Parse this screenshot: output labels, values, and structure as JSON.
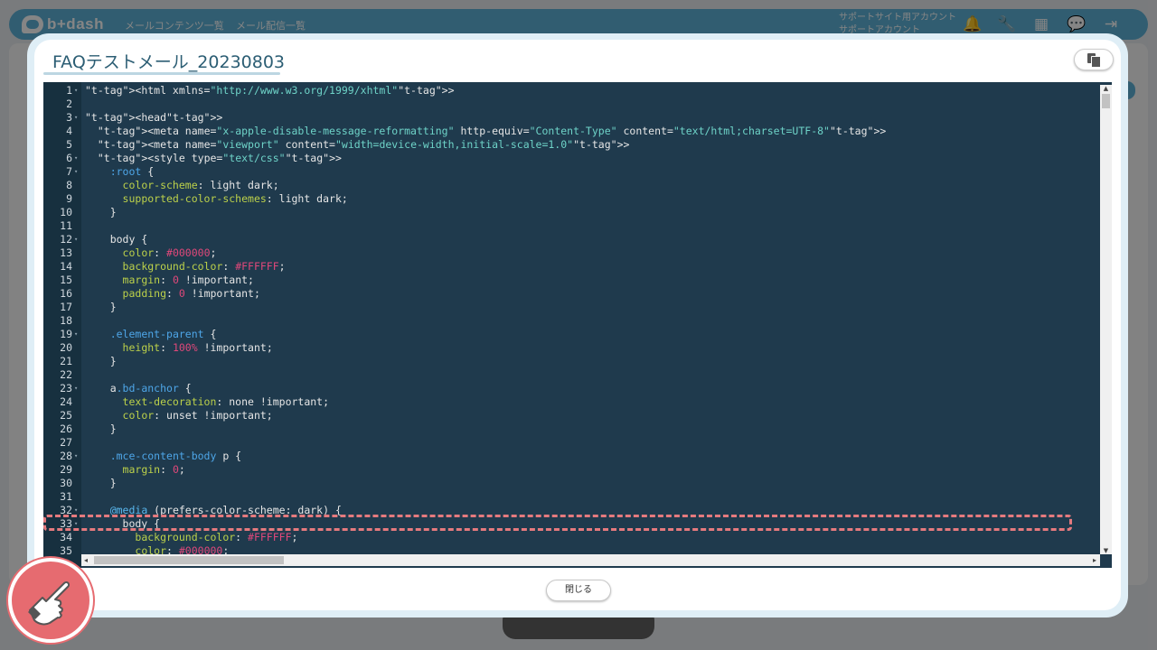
{
  "app": {
    "brand": "b+dash",
    "nav": [
      "メールコンテンツ一覧",
      "メール配信一覧"
    ],
    "account_line1": "サポートサイト用アカウント",
    "account_line2": "サポートアカウント",
    "icons": [
      "bell-icon",
      "wrench-icon",
      "grid-icon",
      "chat-icon",
      "logout-icon"
    ]
  },
  "modal": {
    "title": "FAQテストメール_20230803",
    "copy_icon": "copy-icon",
    "close_label": "閉じる"
  },
  "editor": {
    "lines": [
      "<html xmlns=\"http://www.w3.org/1999/xhtml\">",
      "",
      "<head>",
      "  <meta name=\"x-apple-disable-message-reformatting\" http-equiv=\"Content-Type\" content=\"text/html;charset=UTF-8\">",
      "  <meta name=\"viewport\" content=\"width=device-width,initial-scale=1.0\">",
      "  <style type=\"text/css\">",
      "    :root {",
      "      color-scheme: light dark;",
      "      supported-color-schemes: light dark;",
      "    }",
      "",
      "    body {",
      "      color: #000000;",
      "      background-color: #FFFFFF;",
      "      margin: 0 !important;",
      "      padding: 0 !important;",
      "    }",
      "",
      "    .element-parent {",
      "      height: 100% !important;",
      "    }",
      "",
      "    a.bd-anchor {",
      "      text-decoration: none !important;",
      "      color: unset !important;",
      "    }",
      "",
      "    .mce-content-body p {",
      "      margin: 0;",
      "    }",
      "",
      "    @media (prefers-color-scheme: dark) {",
      "      body {",
      "        background-color: #FFFFFF;",
      "        color: #000000;"
    ],
    "fold_lines": [
      1,
      3,
      6,
      7,
      12,
      19,
      23,
      28,
      32,
      33
    ]
  },
  "colors": {
    "accent": "#5eb3d8",
    "editor_bg": "#1f3a4d",
    "highlight": "#e57a7e"
  }
}
